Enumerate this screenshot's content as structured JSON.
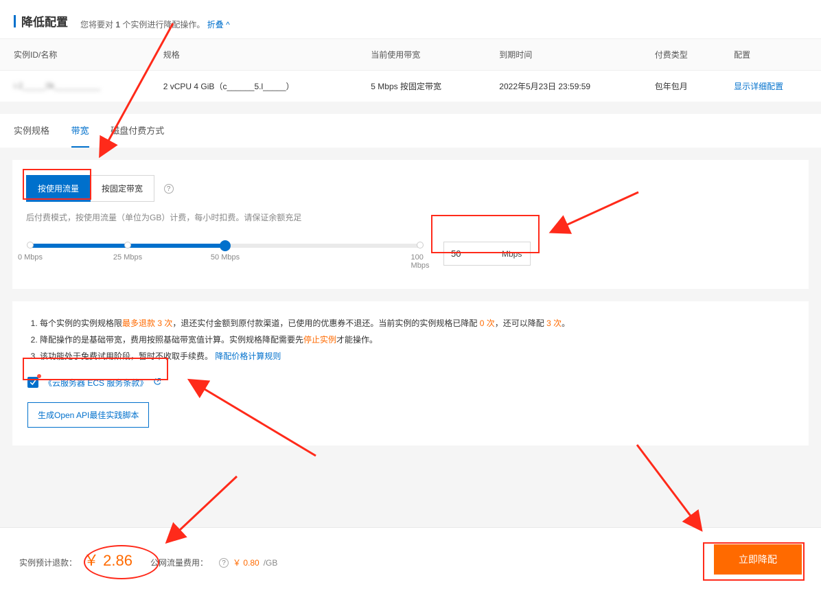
{
  "header": {
    "title": "降低配置",
    "subtitle_prefix": "您将要对 ",
    "subtitle_count": "1",
    "subtitle_suffix": " 个实例进行降配操作。",
    "collapse": "折叠",
    "collapse_icon": "^"
  },
  "table": {
    "cols": [
      "实例ID/名称",
      "规格",
      "当前使用带宽",
      "到期时间",
      "付费类型",
      "配置"
    ],
    "row": {
      "id": "i-2_____0k__________",
      "spec": "2 vCPU 4 GiB（c______5.l_____）",
      "bandwidth": "5 Mbps 按固定带宽",
      "expire": "2022年5月23日 23:59:59",
      "billing": "包年包月",
      "config_link": "显示详细配置"
    }
  },
  "tabs": [
    "实例规格",
    "带宽",
    "磁盘付费方式"
  ],
  "active_tab": 1,
  "bw_panel": {
    "mode_usage": "按使用流量",
    "mode_fixed": "按固定带宽",
    "active_mode": 0,
    "hint": "后付费模式，按使用流量（单位为GB）计费，每小时扣费。请保证余额充足",
    "ticks": [
      "0 Mbps",
      "25 Mbps",
      "50 Mbps",
      "100 Mbps"
    ],
    "value": "50",
    "unit": "Mbps"
  },
  "notes": {
    "n1a": "每个实例的实例规格限",
    "n1b": "最多退款 3 次",
    "n1c": "，退还实付金额到原付款渠道，已使用的优惠券不退还。当前实例的实例规格已降配 ",
    "n1d": "0 次",
    "n1e": "，还可以降配 ",
    "n1f": "3 次",
    "n1g": "。",
    "n2a": "降配操作的是基础带宽，费用按照基础带宽值计算。实例规格降配需要先",
    "n2b": "停止实例",
    "n2c": "才能操作。",
    "n3a": "该功能处于免费试用阶段，暂时不收取手续费。",
    "n3link": "降配价格计算规则"
  },
  "tos": {
    "label": "《云服务器 ECS 服务条款》"
  },
  "openapi_btn": "生成Open API最佳实践脚本",
  "footer": {
    "refund_label": "实例预计退款：",
    "currency": "￥",
    "refund_amount": "2.86",
    "traffic_label": "公网流量费用：",
    "traffic_price": "￥ 0.80",
    "traffic_unit": "/GB",
    "submit": "立即降配"
  }
}
